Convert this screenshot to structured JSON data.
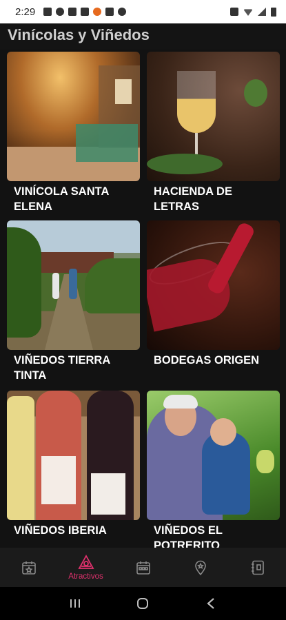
{
  "status_bar": {
    "time": "2:29",
    "left_icons": [
      "message-icon",
      "cloud-icon",
      "photo-icon",
      "alert-icon",
      "app-icon",
      "shield-icon",
      "assistant-icon"
    ],
    "right_icons": [
      "nfc-icon",
      "wifi-icon",
      "signal-icon",
      "battery-icon"
    ]
  },
  "header": {
    "title": "Vinícolas y Viñedos"
  },
  "places": [
    {
      "name": "VINÍCOLA SANTA ELENA",
      "image": "winery-interior-photo"
    },
    {
      "name": "HACIENDA DE LETRAS",
      "image": "white-wine-glass-photo"
    },
    {
      "name": "VIÑEDOS TIERRA TINTA",
      "image": "vineyard-couple-photo"
    },
    {
      "name": "BODEGAS ORIGEN",
      "image": "red-wine-pour-photo"
    },
    {
      "name": "VIÑEDOS IBERIA",
      "image": "wine-bottles-photo"
    },
    {
      "name": "VIÑEDOS EL POTRERITO",
      "image": "grandfather-child-photo"
    }
  ],
  "bottom_nav": {
    "items": [
      {
        "icon": "calendar-star-icon",
        "label": "",
        "active": false
      },
      {
        "icon": "attractions-icon",
        "label": "Atractivos",
        "active": true
      },
      {
        "icon": "calendar-grid-icon",
        "label": "",
        "active": false
      },
      {
        "icon": "location-pin-icon",
        "label": "",
        "active": false
      },
      {
        "icon": "contacts-book-icon",
        "label": "",
        "active": false
      }
    ],
    "active_color": "#e0316d",
    "inactive_color": "#8a8a8a"
  },
  "system_nav": [
    "recents-icon",
    "home-icon",
    "back-icon"
  ]
}
